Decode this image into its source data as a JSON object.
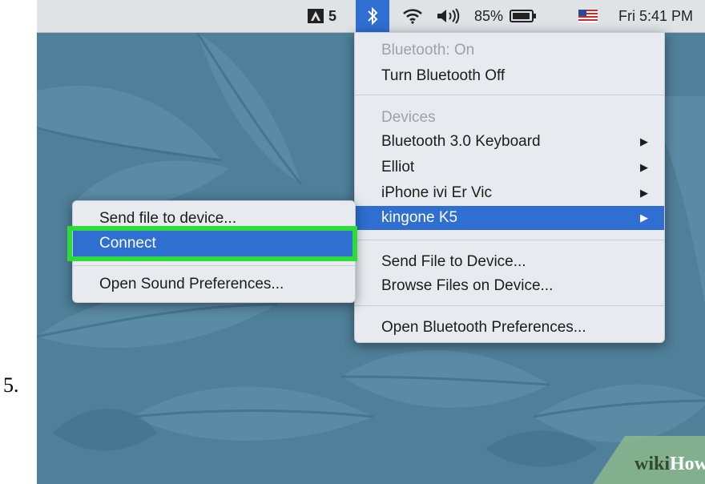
{
  "step_label": "5.",
  "menubar": {
    "adobe_count": "5",
    "battery": "85%",
    "clock": "Fri 5:41 PM"
  },
  "bluetooth_menu": {
    "status": "Bluetooth: On",
    "toggle": "Turn Bluetooth Off",
    "devices_header": "Devices",
    "devices": [
      {
        "label": "Bluetooth 3.0 Keyboard"
      },
      {
        "label": "Elliot"
      },
      {
        "label": "iPhone ivi Er Vic"
      },
      {
        "label": "kingone K5"
      }
    ],
    "send_file": "Send File to Device...",
    "browse_files": "Browse Files on Device...",
    "open_prefs": "Open Bluetooth Preferences..."
  },
  "submenu": {
    "send_file": "Send file to device...",
    "connect": "Connect",
    "open_sound": "Open Sound Preferences..."
  },
  "watermark": {
    "prefix": "wiki",
    "suffix": "How"
  },
  "colors": {
    "selection": "#2f6fd1",
    "highlight": "#2ddb3b",
    "wallpaper": "#4f7f99"
  }
}
